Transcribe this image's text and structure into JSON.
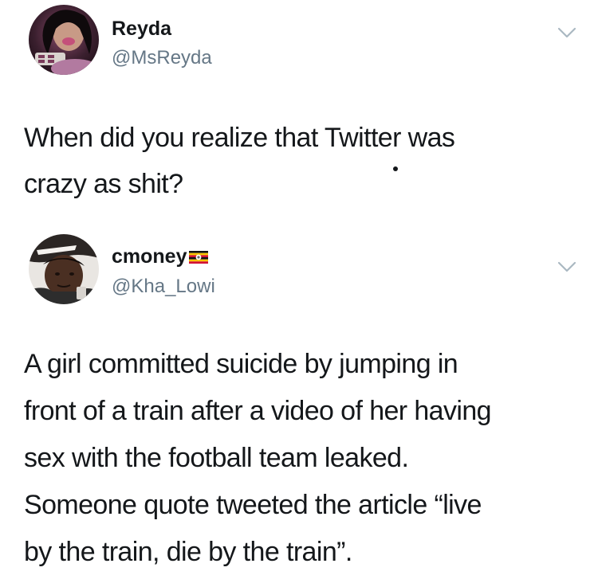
{
  "tweets": [
    {
      "display_name": "Reyda",
      "handle": "@MsReyda",
      "text_lines": [
        "When did you realize that Twitter was",
        "crazy as shit?"
      ],
      "menu_icon": "chevron-down-icon"
    },
    {
      "display_name": "cmoney",
      "name_badge": "flag-icon",
      "handle": "@Kha_Lowi",
      "text_lines": [
        "A girl committed suicide by jumping in",
        "front of a train after a video of her having",
        "sex with the football team leaked.",
        "Someone quote tweeted the article “live",
        "by the train, die by the train”."
      ],
      "menu_icon": "chevron-down-icon"
    }
  ],
  "colors": {
    "text": "#14171a",
    "secondary_text": "#657786",
    "chevron": "#aab8c2",
    "background": "#ffffff"
  }
}
